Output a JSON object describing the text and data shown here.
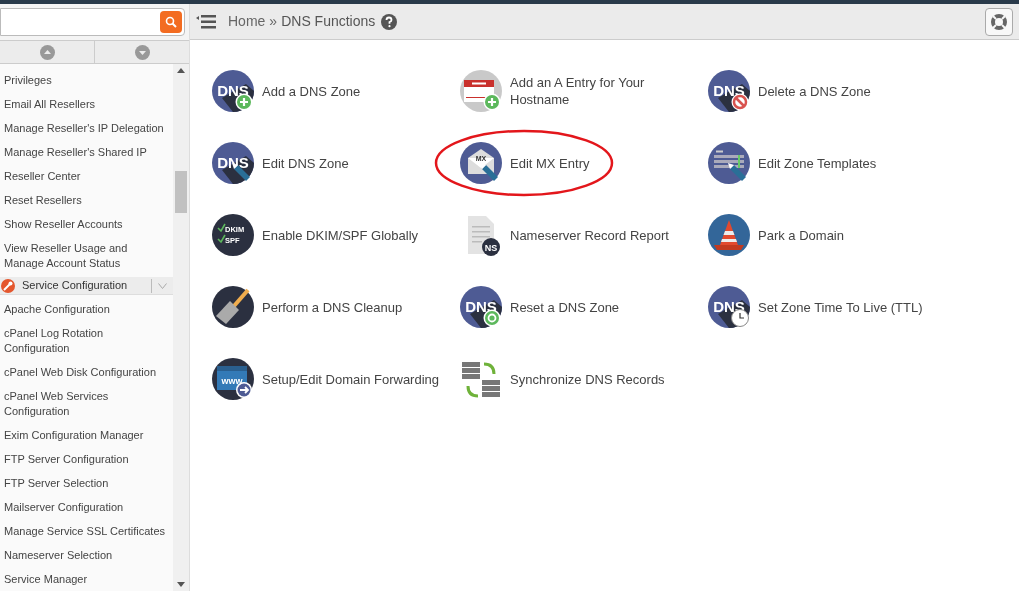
{
  "sidebar": {
    "items": [
      {
        "kind": "link",
        "label": "Privileges"
      },
      {
        "kind": "link",
        "label": "Email All Resellers"
      },
      {
        "kind": "link",
        "label": "Manage Reseller's IP Delegation"
      },
      {
        "kind": "link",
        "label": "Manage Reseller's Shared IP"
      },
      {
        "kind": "link",
        "label": "Reseller Center"
      },
      {
        "kind": "link",
        "label": "Reset Resellers"
      },
      {
        "kind": "link",
        "label": "Show Reseller Accounts"
      },
      {
        "kind": "link",
        "label": "View Reseller Usage and Manage Account Status"
      },
      {
        "kind": "section",
        "label": "Service Configuration",
        "expanded": true
      },
      {
        "kind": "link",
        "label": "Apache Configuration"
      },
      {
        "kind": "link",
        "label": "cPanel Log Rotation Configuration"
      },
      {
        "kind": "link",
        "label": "cPanel Web Disk Configuration"
      },
      {
        "kind": "link",
        "label": "cPanel Web Services Configuration"
      },
      {
        "kind": "link",
        "label": "Exim Configuration Manager"
      },
      {
        "kind": "link",
        "label": "FTP Server Configuration"
      },
      {
        "kind": "link",
        "label": "FTP Server Selection"
      },
      {
        "kind": "link",
        "label": "Mailserver Configuration"
      },
      {
        "kind": "link",
        "label": "Manage Service SSL Certificates"
      },
      {
        "kind": "link",
        "label": "Nameserver Selection"
      },
      {
        "kind": "link",
        "label": "Service Manager"
      }
    ]
  },
  "breadcrumb": {
    "home": "Home",
    "separator": "»",
    "current": "DNS Functions"
  },
  "functions": [
    {
      "kind": "dns-add",
      "icon_text": [
        "DNS"
      ],
      "label": "Add a DNS Zone",
      "highlighted": false
    },
    {
      "kind": "hello-add",
      "label": "Add an A Entry for Your Hostname",
      "highlighted": false
    },
    {
      "kind": "dns-delete",
      "icon_text": [
        "DNS"
      ],
      "label": "Delete a DNS Zone",
      "highlighted": false
    },
    {
      "kind": "dns-edit",
      "icon_text": [
        "DNS"
      ],
      "label": "Edit DNS Zone",
      "highlighted": false
    },
    {
      "kind": "mx-edit",
      "icon_text": [
        "MX"
      ],
      "label": "Edit MX Entry",
      "highlighted": true
    },
    {
      "kind": "template-edit",
      "label": "Edit Zone Templates",
      "highlighted": false
    },
    {
      "kind": "dkim",
      "icon_text": [
        "DKIM",
        "SPF"
      ],
      "label": "Enable DKIM/SPF Globally",
      "highlighted": false
    },
    {
      "kind": "ns-doc",
      "icon_text": [
        "NS"
      ],
      "label": "Nameserver Record Report",
      "highlighted": false
    },
    {
      "kind": "cone",
      "label": "Park a Domain",
      "highlighted": false
    },
    {
      "kind": "broom",
      "label": "Perform a DNS Cleanup",
      "highlighted": false
    },
    {
      "kind": "dns-reset",
      "icon_text": [
        "DNS"
      ],
      "label": "Reset a DNS Zone",
      "highlighted": false
    },
    {
      "kind": "dns-clock",
      "icon_text": [
        "DNS"
      ],
      "label": "Set Zone Time To Live (TTL)",
      "highlighted": false
    },
    {
      "kind": "www-forward",
      "icon_text": [
        "www"
      ],
      "label": "Setup/Edit Domain Forwarding",
      "highlighted": false
    },
    {
      "kind": "sync",
      "label": "Synchronize DNS Records",
      "highlighted": false
    }
  ]
}
